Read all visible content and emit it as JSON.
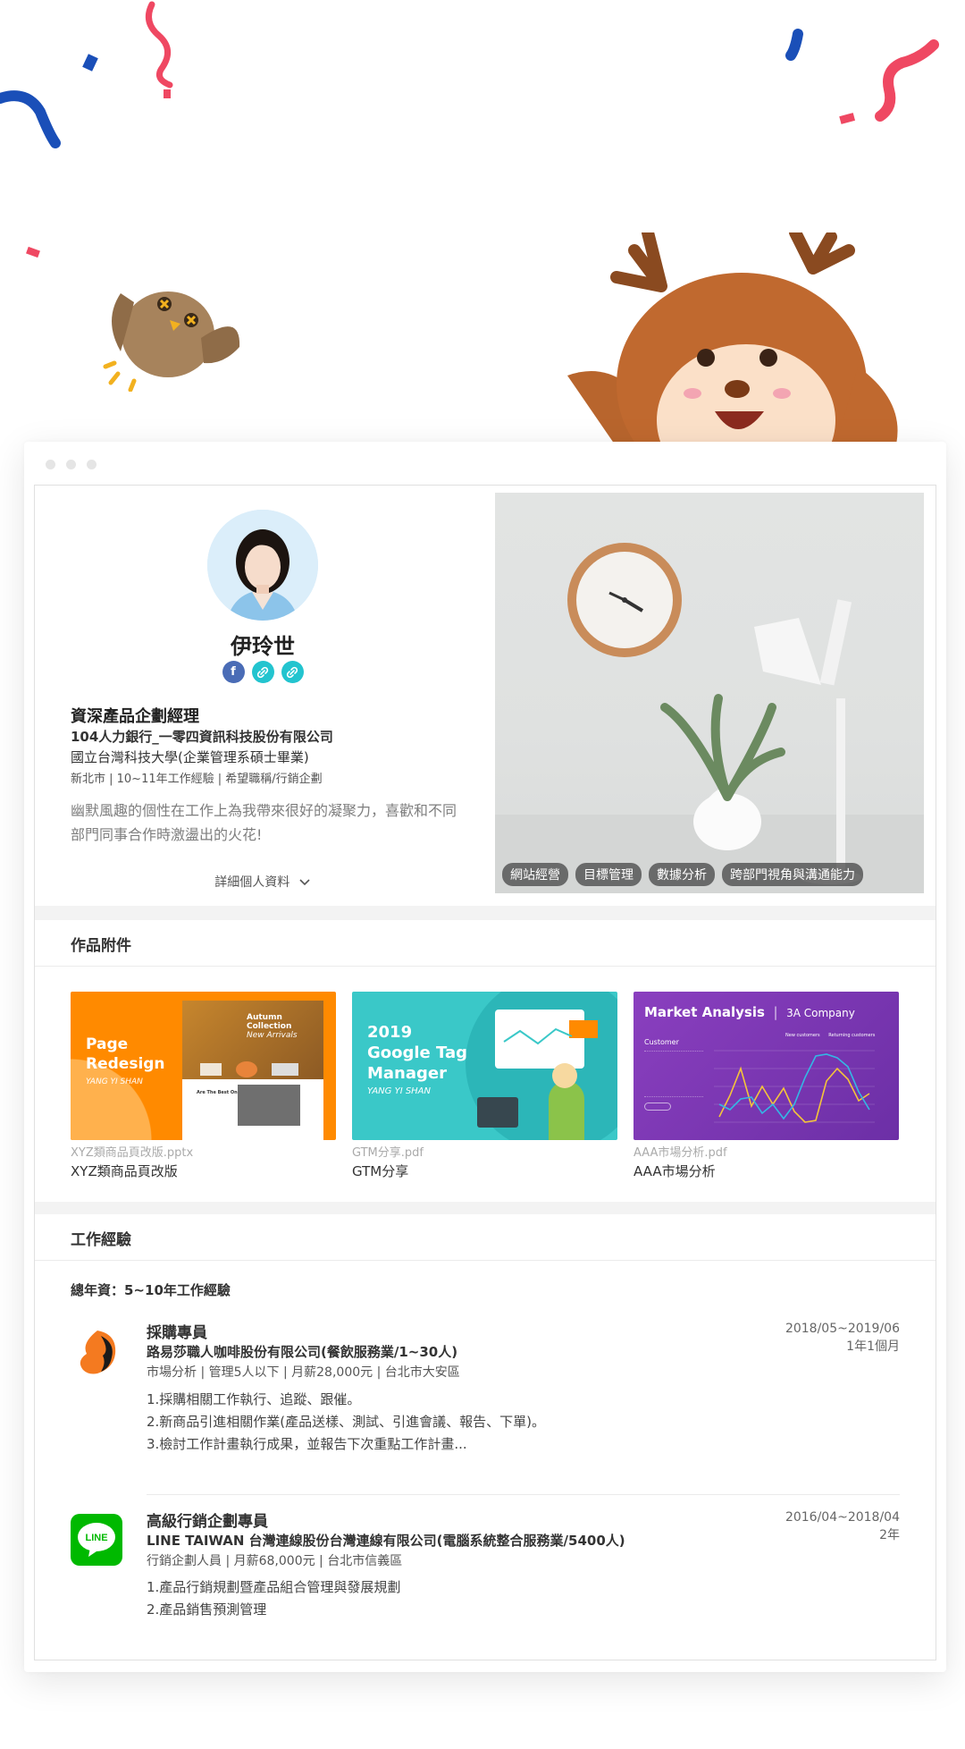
{
  "profile": {
    "name": "伊玲世",
    "social_icons": [
      "facebook-icon",
      "link-icon",
      "link-icon"
    ],
    "job_title": "資深產品企劃經理",
    "company": "104人力銀行_一零四資訊科技股份有限公司",
    "education": "國立台灣科技大學(企業管理系碩士畢業)",
    "meta": "新北市 | 10~11年工作經驗 | 希望職稱/行銷企劃",
    "intro": "幽默風趣的個性在工作上為我帶來很好的凝聚力，喜歡和不同部門同事合作時激盪出的火花!",
    "detail_link": "詳細個人資料",
    "skills": [
      "網站經營",
      "目標管理",
      "數據分析",
      "跨部門視角與溝通能力"
    ]
  },
  "attachments": {
    "title": "作品附件",
    "items": [
      {
        "file": "XYZ類商品頁改版.pptx",
        "title": "XYZ類商品頁改版",
        "thumb_lines": [
          "Page",
          "Redesign"
        ],
        "thumb_sub": "YANG YI SHAN",
        "thumb_caption": [
          "Autumn",
          "Collection"
        ],
        "thumb_caption2": "New Arrivals",
        "thumb_caption3": "Are The Best Ones"
      },
      {
        "file": "GTM分享.pdf",
        "title": "GTM分享",
        "thumb_lines": [
          "2019",
          "Google Tag",
          "Manager"
        ],
        "thumb_sub": "YANG YI SHAN"
      },
      {
        "file": "AAA市場分析.pdf",
        "title": "AAA市場分析",
        "thumb_title": "Market Analysis",
        "thumb_company": "3A Company",
        "thumb_label": "Customer",
        "thumb_legend": [
          "New customers",
          "Returning customers"
        ]
      }
    ]
  },
  "experience": {
    "title": "工作經驗",
    "total": "總年資：5~10年工作經驗",
    "jobs": [
      {
        "title": "採購專員",
        "company": "路易莎職人咖啡股份有限公司(餐飲服務業/1~30人)",
        "meta": "市場分析 | 管理5人以下 | 月薪28,000元 | 台北市大安區",
        "duties": [
          "1.採購相關工作執行、追蹤、跟催。",
          "2.新商品引進相關作業(產品送樣、測試、引進會議、報告、下單)。",
          "3.檢討工作計畫執行成果，並報告下次重點工作計畫..."
        ],
        "period": "2018/05~2019/06",
        "duration": "1年1個月"
      },
      {
        "title": "高級行銷企劃專員",
        "company": "LINE TAIWAN 台灣連線股份台灣連線有限公司(電腦系統整合服務業/5400人)",
        "meta": "行銷企劃人員 | 月薪68,000元 | 台北市信義區",
        "duties": [
          "1.產品行銷規劃暨產品組合管理與發展規劃",
          "2.產品銷售預測管理"
        ],
        "period": "2016/04~2018/04",
        "duration": "2年",
        "logo_text": "LINE"
      }
    ]
  },
  "colors": {
    "facebook": "#4a6cb6",
    "link": "#23c4cf",
    "orange": "#ff8a00",
    "teal": "#3ac8c8",
    "purple": "#7b3fb5",
    "line_green": "#00b900"
  }
}
